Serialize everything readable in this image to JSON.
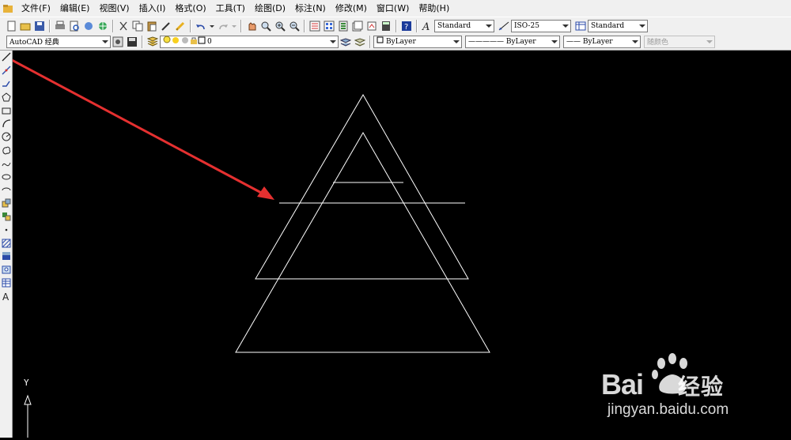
{
  "menubar": {
    "items": [
      "文件(F)",
      "编辑(E)",
      "视图(V)",
      "插入(I)",
      "格式(O)",
      "工具(T)",
      "绘图(D)",
      "标注(N)",
      "修改(M)",
      "窗口(W)",
      "帮助(H)"
    ]
  },
  "styles_toolbar": {
    "text_style": "Standard",
    "dim_style": "ISO-25",
    "table_style": "Standard"
  },
  "toolbar2": {
    "workspace": "AutoCAD 经典",
    "layer": "0",
    "color": "ByLayer",
    "linetype": "————— ByLayer",
    "lineweight": "—— ByLayer",
    "plot_style": "随颜色"
  },
  "canvas": {
    "background": "#000000",
    "ucs_axis_label": "Y",
    "line_color": "#ffffff",
    "annotation_arrow_color": "#e53030"
  },
  "watermark": {
    "brand": "Bai",
    "brand_suffix": "经验",
    "url": "jingyan.baidu.com"
  }
}
